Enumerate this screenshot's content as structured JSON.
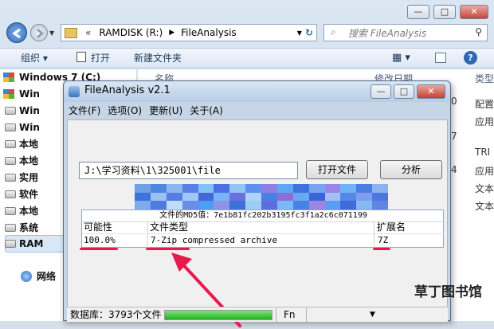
{
  "explorer": {
    "address": {
      "separator": "«",
      "segments": [
        "RAMDISK (R:)",
        "FileAnalysis"
      ]
    },
    "search_placeholder": "搜索 FileAnalysis",
    "toolbar": {
      "organize": "组织",
      "open": "打开",
      "new_folder": "新建文件夹"
    },
    "nav": [
      "Windows 7 (C:)",
      "Win",
      "Win",
      "Win",
      "本地",
      "本地",
      "实用",
      "软件",
      "本地",
      "系统",
      "RAM",
      "网络"
    ],
    "columns": {
      "name": "名称",
      "date": "修改日期",
      "type": "类型"
    },
    "right_col_cells": [
      "0",
      "7",
      "4"
    ],
    "type_cells": [
      "配置",
      "应用",
      "TRI",
      "应用",
      "文本",
      "文本"
    ]
  },
  "app": {
    "title": "FileAnalysis v2.1",
    "menu": [
      "文件(F)",
      "选项(O)",
      "更新(U)",
      "关于(A)"
    ],
    "path_value": "J:\\学习资料\\1\\325001\\file",
    "open_button": "打开文件",
    "analyze_button": "分析",
    "md5_label": "文件的MD5值：7e1b81fc202b3195fc3f1a2c6c071199",
    "result": {
      "headers": [
        "可能性",
        "文件类型",
        "扩展名"
      ],
      "row": [
        "100.0%",
        "7-Zip compressed archive",
        "7Z"
      ]
    },
    "status": {
      "db": "数据库：3793个文件",
      "fn": "Fn"
    }
  },
  "watermark": "草丁图书馆"
}
